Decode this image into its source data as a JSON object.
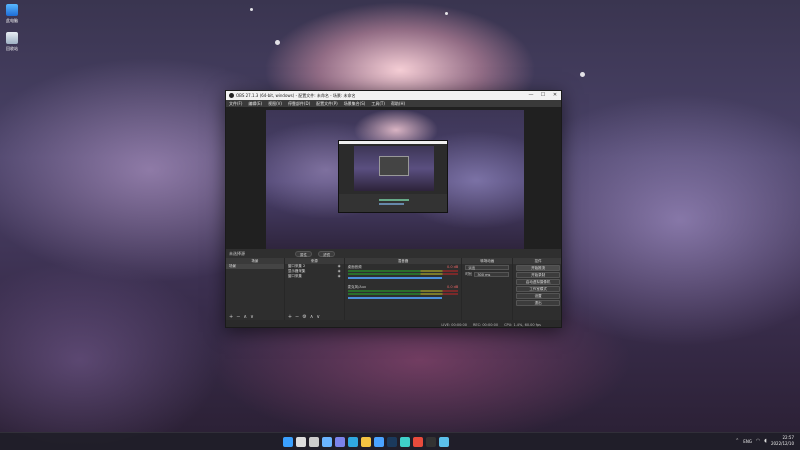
{
  "desktop": {
    "icons": [
      {
        "label": "此电脑",
        "icon": "computer-icon"
      },
      {
        "label": "回收站",
        "icon": "recycle-bin-icon"
      }
    ]
  },
  "obs": {
    "title": "OBS 27.1.3 (64-bit, windows) - 配置文件: 未命名 - 场景: 未命名",
    "window_controls": [
      "—",
      "☐",
      "✕"
    ],
    "menu": [
      "文件(F)",
      "编辑(E)",
      "视图(V)",
      "停靠部件(D)",
      "配置文件(P)",
      "场景集合(S)",
      "工具(T)",
      "帮助(H)"
    ],
    "scene_bar": {
      "label": "未选择源",
      "properties": "属性",
      "filters": "滤镜"
    },
    "docks": {
      "scenes": {
        "title": "场景",
        "items": [
          "场景"
        ]
      },
      "sources": {
        "title": "来源",
        "items": [
          "窗口采集 2",
          "显示器采集",
          "窗口采集"
        ]
      },
      "mixer": {
        "title": "混音器",
        "channels": [
          {
            "name": "桌面音频",
            "level": "0.0 dB"
          },
          {
            "name": "麦克风/Aux",
            "level": "0.0 dB"
          }
        ]
      },
      "transitions": {
        "title": "转场动画",
        "type": "淡出",
        "duration_label": "时长",
        "duration": "300 ms"
      },
      "controls": {
        "title": "控件",
        "buttons": [
          "开始推流",
          "开始录制",
          "启动虚拟摄像机",
          "工作室模式",
          "设置",
          "退出"
        ]
      }
    },
    "dock_footer": {
      "add": "+",
      "remove": "−",
      "up": "∧",
      "down": "∨",
      "settings": "⚙"
    },
    "status": {
      "live": "LIVE: 00:00:00",
      "rec": "REC: 00:00:00",
      "cpu": "CPU: 1.4%, 60.00 fps"
    }
  },
  "taskbar": {
    "icons": [
      {
        "name": "windows-start-icon",
        "color": "#3aa0ff"
      },
      {
        "name": "search-icon",
        "color": "#dddddd"
      },
      {
        "name": "task-view-icon",
        "color": "#cccccc"
      },
      {
        "name": "widgets-icon",
        "color": "#6ab4ff"
      },
      {
        "name": "chat-icon",
        "color": "#7b83eb"
      },
      {
        "name": "edge-icon",
        "color": "#2fa8e0"
      },
      {
        "name": "file-explorer-icon",
        "color": "#f5c542"
      },
      {
        "name": "store-icon",
        "color": "#4aa3ff"
      },
      {
        "name": "steam-icon",
        "color": "#1b3a5c"
      },
      {
        "name": "app-icon",
        "color": "#3fd0c9"
      },
      {
        "name": "chrome-icon",
        "color": "#e94b3c"
      },
      {
        "name": "obs-icon",
        "color": "#333333"
      },
      {
        "name": "app2-icon",
        "color": "#5bc0eb"
      }
    ],
    "tray": {
      "ime": "ENG",
      "time": "22:57",
      "date": "2022/12/10"
    }
  },
  "colors": {
    "obs_bg": "#2b2b2b",
    "accent": "#4a8ed8"
  }
}
